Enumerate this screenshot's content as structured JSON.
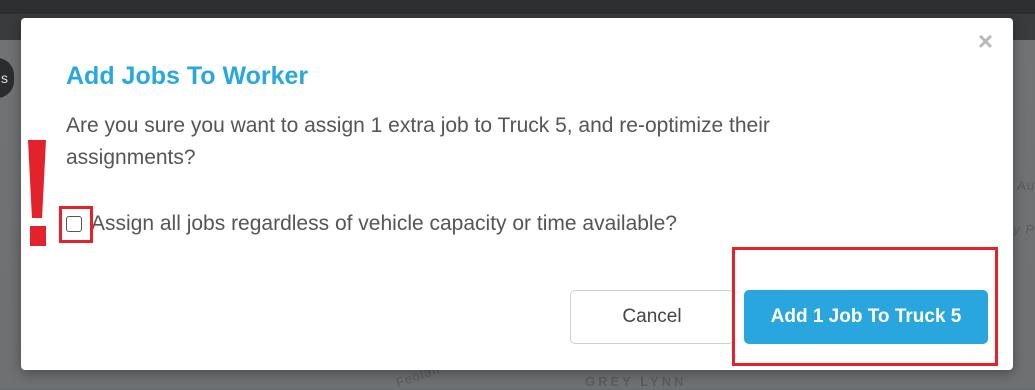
{
  "background": {
    "left_pill_text": "s",
    "map_labels": [
      "Au",
      "y P",
      "GREY LYNN",
      "Feolan"
    ]
  },
  "modal": {
    "title": "Add Jobs To Worker",
    "close_glyph": "×",
    "message": "Are you sure you want to assign 1 extra job to Truck 5, and re-optimize their assignments?",
    "checkbox": {
      "label": "Assign all jobs regardless of vehicle capacity or time available?",
      "checked": false
    },
    "buttons": {
      "cancel": "Cancel",
      "confirm": "Add 1 Job To Truck 5"
    }
  },
  "annotation": {
    "exclamation": "!",
    "color": "#e3222b"
  },
  "colors": {
    "title": "#29a8dd",
    "primary_button": "#2aa6de",
    "body_text": "#555555"
  }
}
